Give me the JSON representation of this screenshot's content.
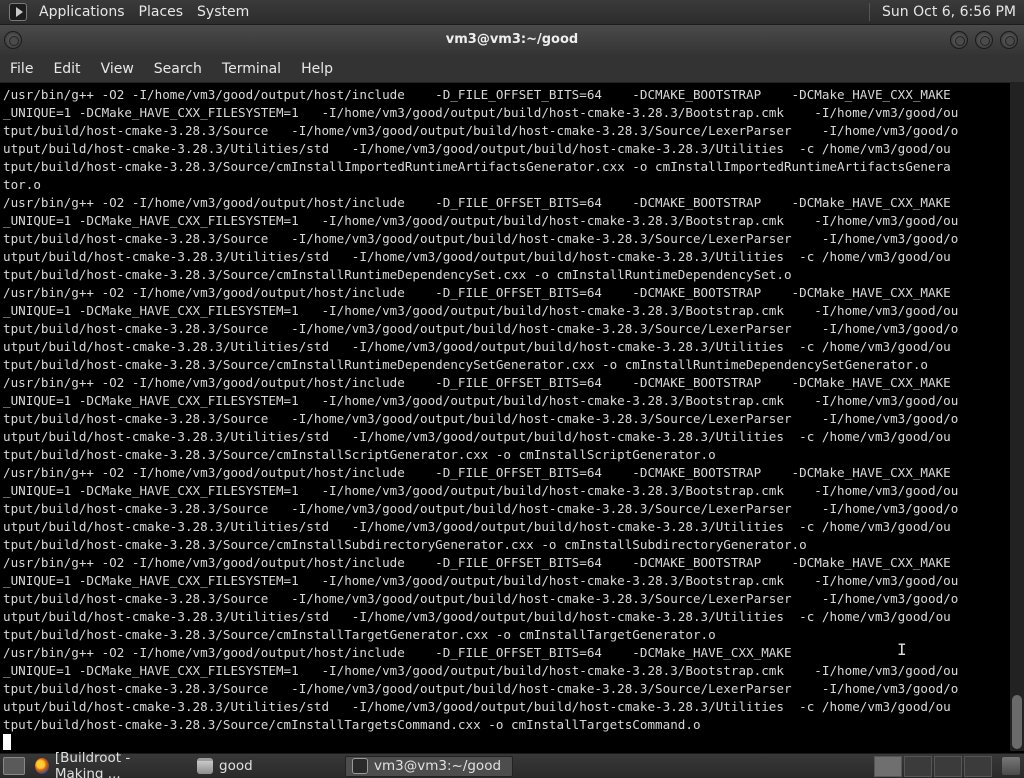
{
  "top_panel": {
    "menus": [
      "Applications",
      "Places",
      "System"
    ],
    "clock": "Sun Oct  6, 6:56 PM"
  },
  "window": {
    "title": "vm3@vm3:~/good",
    "menus": [
      "File",
      "Edit",
      "View",
      "Search",
      "Terminal",
      "Help"
    ]
  },
  "terminal": {
    "lines": [
      "/usr/bin/g++ -O2 -I/home/vm3/good/output/host/include    -D_FILE_OFFSET_BITS=64    -DCMAKE_BOOTSTRAP    -DCMake_HAVE_CXX_MAKE",
      "_UNIQUE=1 -DCMake_HAVE_CXX_FILESYSTEM=1   -I/home/vm3/good/output/build/host-cmake-3.28.3/Bootstrap.cmk    -I/home/vm3/good/ou",
      "tput/build/host-cmake-3.28.3/Source   -I/home/vm3/good/output/build/host-cmake-3.28.3/Source/LexerParser    -I/home/vm3/good/o",
      "utput/build/host-cmake-3.28.3/Utilities/std   -I/home/vm3/good/output/build/host-cmake-3.28.3/Utilities  -c /home/vm3/good/ou",
      "tput/build/host-cmake-3.28.3/Source/cmInstallImportedRuntimeArtifactsGenerator.cxx -o cmInstallImportedRuntimeArtifactsGenera",
      "tor.o",
      "/usr/bin/g++ -O2 -I/home/vm3/good/output/host/include    -D_FILE_OFFSET_BITS=64    -DCMAKE_BOOTSTRAP    -DCMake_HAVE_CXX_MAKE",
      "_UNIQUE=1 -DCMake_HAVE_CXX_FILESYSTEM=1   -I/home/vm3/good/output/build/host-cmake-3.28.3/Bootstrap.cmk    -I/home/vm3/good/ou",
      "tput/build/host-cmake-3.28.3/Source   -I/home/vm3/good/output/build/host-cmake-3.28.3/Source/LexerParser    -I/home/vm3/good/o",
      "utput/build/host-cmake-3.28.3/Utilities/std   -I/home/vm3/good/output/build/host-cmake-3.28.3/Utilities  -c /home/vm3/good/ou",
      "tput/build/host-cmake-3.28.3/Source/cmInstallRuntimeDependencySet.cxx -o cmInstallRuntimeDependencySet.o",
      "/usr/bin/g++ -O2 -I/home/vm3/good/output/host/include    -D_FILE_OFFSET_BITS=64    -DCMAKE_BOOTSTRAP    -DCMake_HAVE_CXX_MAKE",
      "_UNIQUE=1 -DCMake_HAVE_CXX_FILESYSTEM=1   -I/home/vm3/good/output/build/host-cmake-3.28.3/Bootstrap.cmk    -I/home/vm3/good/ou",
      "tput/build/host-cmake-3.28.3/Source   -I/home/vm3/good/output/build/host-cmake-3.28.3/Source/LexerParser    -I/home/vm3/good/o",
      "utput/build/host-cmake-3.28.3/Utilities/std   -I/home/vm3/good/output/build/host-cmake-3.28.3/Utilities  -c /home/vm3/good/ou",
      "tput/build/host-cmake-3.28.3/Source/cmInstallRuntimeDependencySetGenerator.cxx -o cmInstallRuntimeDependencySetGenerator.o",
      "/usr/bin/g++ -O2 -I/home/vm3/good/output/host/include    -D_FILE_OFFSET_BITS=64    -DCMAKE_BOOTSTRAP    -DCMake_HAVE_CXX_MAKE",
      "_UNIQUE=1 -DCMake_HAVE_CXX_FILESYSTEM=1   -I/home/vm3/good/output/build/host-cmake-3.28.3/Bootstrap.cmk    -I/home/vm3/good/ou",
      "tput/build/host-cmake-3.28.3/Source   -I/home/vm3/good/output/build/host-cmake-3.28.3/Source/LexerParser    -I/home/vm3/good/o",
      "utput/build/host-cmake-3.28.3/Utilities/std   -I/home/vm3/good/output/build/host-cmake-3.28.3/Utilities  -c /home/vm3/good/ou",
      "tput/build/host-cmake-3.28.3/Source/cmInstallScriptGenerator.cxx -o cmInstallScriptGenerator.o",
      "/usr/bin/g++ -O2 -I/home/vm3/good/output/host/include    -D_FILE_OFFSET_BITS=64    -DCMAKE_BOOTSTRAP    -DCMake_HAVE_CXX_MAKE",
      "_UNIQUE=1 -DCMake_HAVE_CXX_FILESYSTEM=1   -I/home/vm3/good/output/build/host-cmake-3.28.3/Bootstrap.cmk    -I/home/vm3/good/ou",
      "tput/build/host-cmake-3.28.3/Source   -I/home/vm3/good/output/build/host-cmake-3.28.3/Source/LexerParser    -I/home/vm3/good/o",
      "utput/build/host-cmake-3.28.3/Utilities/std   -I/home/vm3/good/output/build/host-cmake-3.28.3/Utilities  -c /home/vm3/good/ou",
      "tput/build/host-cmake-3.28.3/Source/cmInstallSubdirectoryGenerator.cxx -o cmInstallSubdirectoryGenerator.o",
      "/usr/bin/g++ -O2 -I/home/vm3/good/output/host/include    -D_FILE_OFFSET_BITS=64    -DCMAKE_BOOTSTRAP    -DCMake_HAVE_CXX_MAKE",
      "_UNIQUE=1 -DCMake_HAVE_CXX_FILESYSTEM=1   -I/home/vm3/good/output/build/host-cmake-3.28.3/Bootstrap.cmk    -I/home/vm3/good/ou",
      "tput/build/host-cmake-3.28.3/Source   -I/home/vm3/good/output/build/host-cmake-3.28.3/Source/LexerParser    -I/home/vm3/good/o",
      "utput/build/host-cmake-3.28.3/Utilities/std   -I/home/vm3/good/output/build/host-cmake-3.28.3/Utilities  -c /home/vm3/good/ou",
      "tput/build/host-cmake-3.28.3/Source/cmInstallTargetGenerator.cxx -o cmInstallTargetGenerator.o",
      "/usr/bin/g++ -O2 -I/home/vm3/good/output/host/include    -D_FILE_OFFSET_BITS=64    -DCMake_HAVE_CXX_MAKE",
      "_UNIQUE=1 -DCMake_HAVE_CXX_FILESYSTEM=1   -I/home/vm3/good/output/build/host-cmake-3.28.3/Bootstrap.cmk    -I/home/vm3/good/ou",
      "tput/build/host-cmake-3.28.3/Source   -I/home/vm3/good/output/build/host-cmake-3.28.3/Source/LexerParser    -I/home/vm3/good/o",
      "utput/build/host-cmake-3.28.3/Utilities/std   -I/home/vm3/good/output/build/host-cmake-3.28.3/Utilities  -c /home/vm3/good/ou",
      "tput/build/host-cmake-3.28.3/Source/cmInstallTargetsCommand.cxx -o cmInstallTargetsCommand.o"
    ]
  },
  "taskbar": {
    "tasks": [
      {
        "label": "[Buildroot - Making ...",
        "icon": "firefox-icon"
      },
      {
        "label": "good",
        "icon": "folder-icon"
      },
      {
        "label": "vm3@vm3:~/good",
        "icon": "terminal-icon"
      }
    ]
  }
}
